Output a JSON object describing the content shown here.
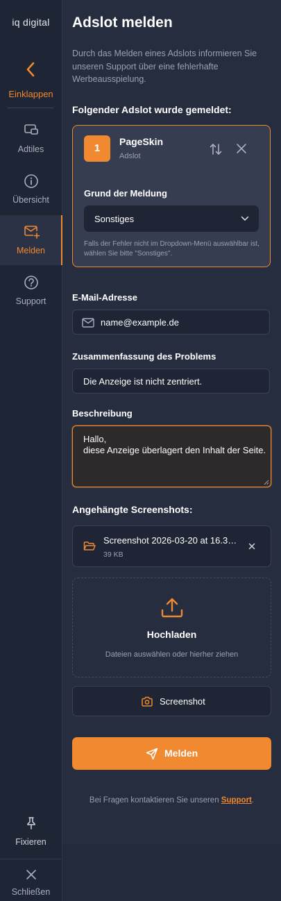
{
  "sidebar": {
    "logo": "iq digital",
    "collapse_label": "Einklappen",
    "items": [
      {
        "label": "Adtiles",
        "icon": "adtiles-icon"
      },
      {
        "label": "Übersicht",
        "icon": "info-icon"
      },
      {
        "label": "Melden",
        "icon": "mail-plus-icon",
        "active": true
      },
      {
        "label": "Support",
        "icon": "help-icon"
      }
    ],
    "pin_label": "Fixieren",
    "close_label": "Schließen"
  },
  "main": {
    "title": "Adslot melden",
    "intro": "Durch das Melden eines Adslots informieren Sie unseren Support über eine fehlerhafte Werbeausspielung.",
    "reported_heading": "Folgender Adslot wurde gemeldet:",
    "adslot": {
      "number": "1",
      "name": "PageSkin",
      "type": "Adslot",
      "reason_label": "Grund der Meldung",
      "reason_value": "Sonstiges",
      "reason_hint": "Falls der Fehler nicht im Dropdown-Menü auswählbar ist, wählen Sie bitte \"Sonstiges\"."
    },
    "email": {
      "label": "E-Mail-Adresse",
      "value": "name@example.de"
    },
    "summary": {
      "label": "Zusammenfassung des Problems",
      "value": "Die Anzeige ist nicht zentriert."
    },
    "description": {
      "label": "Beschreibung",
      "value": "Hallo,\ndiese Anzeige überlagert den Inhalt der Seite."
    },
    "attachments_heading": "Angehängte Screenshots:",
    "attachment": {
      "name": "Screenshot 2026-03-20 at 16.3…",
      "size": "39 KB"
    },
    "upload": {
      "title": "Hochladen",
      "subtitle": "Dateien auswählen oder hierher ziehen"
    },
    "screenshot_button": "Screenshot",
    "submit_button": "Melden",
    "footer_text": "Bei Fragen kontaktieren Sie unseren ",
    "footer_link": "Support",
    "footer_end": "."
  },
  "colors": {
    "accent": "#f0892f",
    "background": "#232a3b",
    "panel": "#262d3e",
    "input": "#1f2534"
  }
}
